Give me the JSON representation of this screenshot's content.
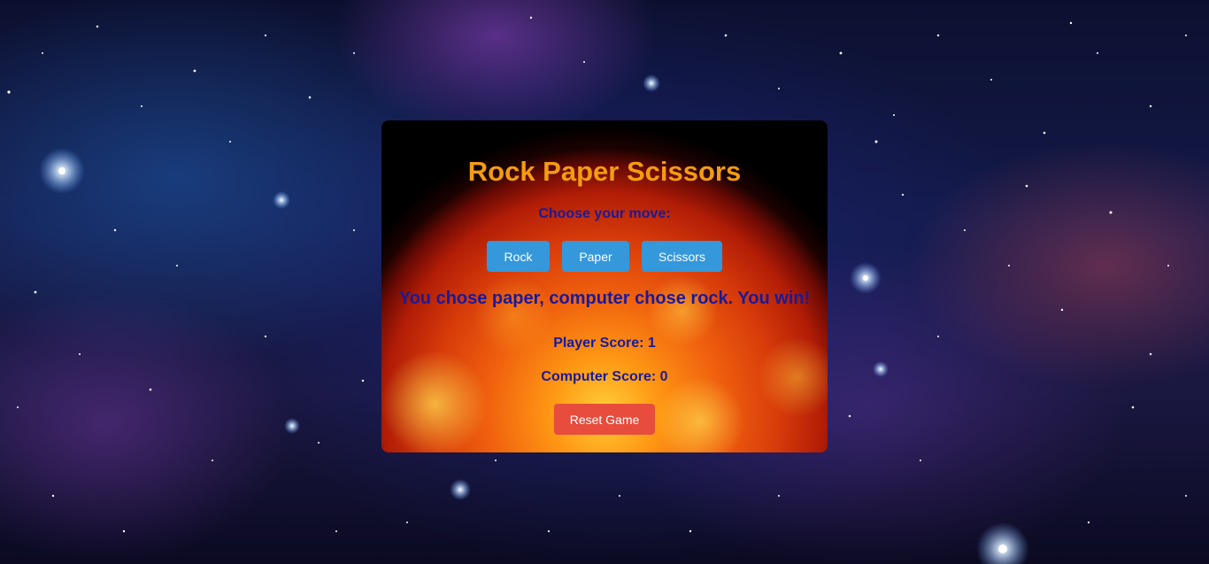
{
  "game": {
    "title": "Rock Paper Scissors",
    "prompt": "Choose your move:",
    "moves": {
      "rock": "Rock",
      "paper": "Paper",
      "scissors": "Scissors"
    },
    "result": "You chose paper, computer chose rock. You win!",
    "player_score_text": "Player Score: 1",
    "computer_score_text": "Computer Score: 0",
    "reset_label": "Reset Game"
  },
  "scores": {
    "player": 1,
    "computer": 0
  },
  "colors": {
    "title": "#f39c12",
    "text": "#1a1a9a",
    "move_button": "#3498db",
    "reset_button": "#e74c3c"
  }
}
